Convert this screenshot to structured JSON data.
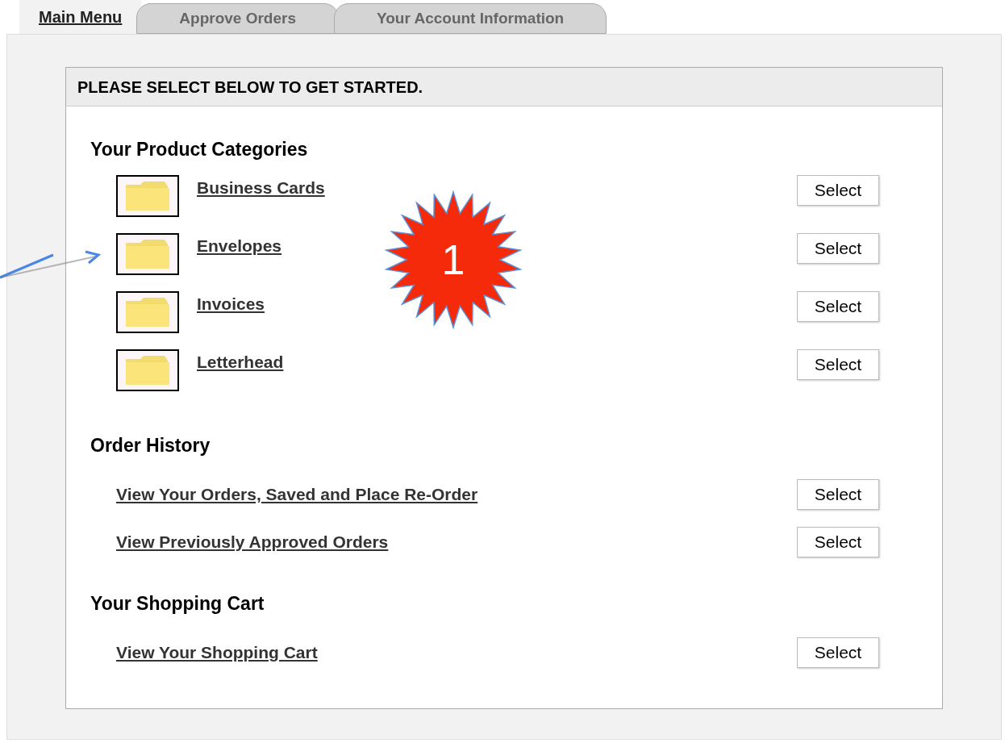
{
  "tabs": [
    {
      "label": "Main Menu",
      "selected": true
    },
    {
      "label": "Approve Orders",
      "selected": false
    },
    {
      "label": "Your Account Information",
      "selected": false
    }
  ],
  "header": "PLEASE SELECT BELOW TO GET STARTED.",
  "sections": [
    {
      "title": "Your Product Categories",
      "items": [
        {
          "kind": "folder",
          "label": "Business Cards",
          "button": "Select"
        },
        {
          "kind": "folder",
          "label": "Envelopes",
          "button": "Select"
        },
        {
          "kind": "folder",
          "label": "Invoices",
          "button": "Select"
        },
        {
          "kind": "folder",
          "label": "Letterhead",
          "button": "Select"
        }
      ]
    },
    {
      "title": "Order History",
      "items": [
        {
          "kind": "link",
          "label": "View Your Orders, Saved and Place Re-Order",
          "button": "Select"
        },
        {
          "kind": "link",
          "label": "View Previously Approved Orders",
          "button": "Select"
        }
      ]
    },
    {
      "title": "Your Shopping Cart",
      "items": [
        {
          "kind": "link",
          "label": "View Your Shopping Cart",
          "button": "Select"
        }
      ]
    }
  ],
  "callout": {
    "number": "1"
  }
}
